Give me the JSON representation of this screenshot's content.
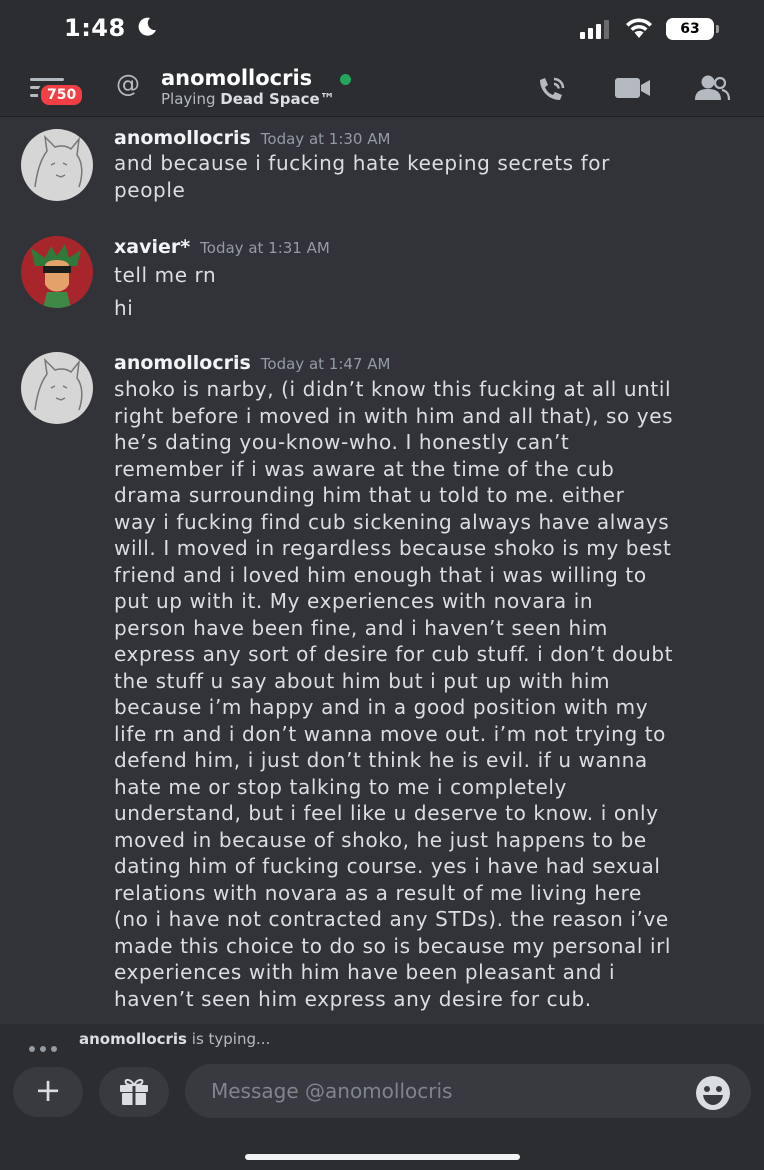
{
  "status_bar": {
    "time": "1:48",
    "battery": "63"
  },
  "header": {
    "badge_count": "750",
    "at_symbol": "@",
    "username": "anomollocris",
    "activity_prefix": "Playing",
    "activity_game": "Dead Space™"
  },
  "messages": [
    {
      "author": "anomollocris",
      "timestamp": "Today at 1:30 AM",
      "lines": [
        "and because i fucking hate keeping secrets for",
        "people"
      ]
    },
    {
      "author": "xavier*",
      "timestamp": "Today at 1:31 AM",
      "lines": [
        "tell me rn"
      ],
      "extra": "hi"
    },
    {
      "author": "anomollocris",
      "timestamp": "Today at 1:47 AM",
      "lines": [
        "shoko is narby, (i didn’t know this fucking at all until",
        "right before i moved in with him and all that), so yes",
        "he’s dating you-know-who. I honestly can’t",
        "remember if i was aware at the time of the cub",
        "drama surrounding him that u told to me. either",
        "way i fucking find cub sickening always have always",
        "will. I moved in regardless because shoko is my best",
        "friend and i loved him enough that i was willing to",
        "put up with it. My experiences with novara in",
        "person have been fine, and i haven’t seen him",
        "express any sort of desire for cub stuff. i don’t doubt",
        "the stuff u say about him but i put up with him",
        "because i’m happy and in a good position with my",
        "life rn and i don’t wanna move out. i’m not trying to",
        "defend him, i just don’t think he is evil. if u wanna",
        "hate me or stop talking to me i completely",
        "understand, but i feel like u deserve to know. i only",
        "moved in because of shoko, he just happens to be",
        "dating him of fucking course. yes i have had sexual",
        "relations with novara as a result of me living here",
        "(no i have not contracted any STDs). the reason i’ve",
        "made this choice to do so is because my personal irl",
        "experiences with him have been pleasant and i",
        "haven’t seen him express any desire for cub."
      ]
    }
  ],
  "typing": {
    "user": "anomollocris",
    "suffix": "is typing..."
  },
  "composer": {
    "plus": "+",
    "placeholder": "Message @anomollocris"
  },
  "icons": {
    "menu": "hamburger-icon",
    "at": "at-icon",
    "call": "phone-call-icon",
    "video": "video-camera-icon",
    "members": "members-icon",
    "gift": "gift-icon",
    "emoji": "smiley-icon",
    "moon": "moon-icon",
    "signal": "cellular-signal-icon",
    "wifi": "wifi-icon"
  },
  "colors": {
    "background": "#313338",
    "header": "#2b2d31",
    "badge": "#f23f43",
    "online": "#23a55a",
    "input": "#383a40"
  }
}
